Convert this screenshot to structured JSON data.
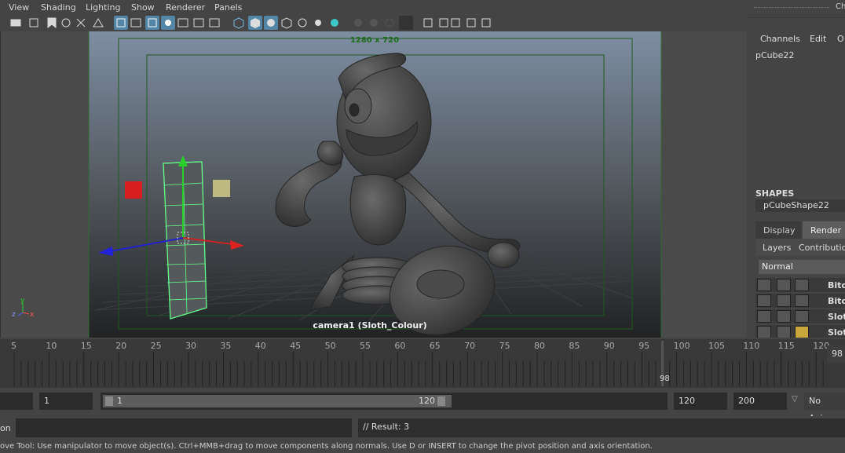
{
  "menu": [
    "View",
    "Shading",
    "Lighting",
    "Show",
    "Renderer",
    "Panels"
  ],
  "viewport": {
    "resolution_label": "1280 x 720",
    "camera_label": "camera1 (Sloth_Colour)",
    "axis_labels": {
      "y": "y",
      "z": "z",
      "x": "x"
    }
  },
  "right_panel": {
    "top_label": "Ch",
    "channels_menu": [
      "Channels",
      "Edit",
      "O"
    ],
    "object_name": "pCube22",
    "shapes_header": "SHAPES",
    "shape_name": "pCubeShape22",
    "tabs": [
      "Display",
      "Render"
    ],
    "subtabs": [
      "Layers",
      "Contribution"
    ],
    "blend_mode": "Normal",
    "layers": [
      "Bitco",
      "Bitco",
      "Sloth",
      "Sloth"
    ]
  },
  "timeslider": {
    "ticks": [
      "5",
      "10",
      "15",
      "20",
      "25",
      "30",
      "35",
      "40",
      "45",
      "50",
      "55",
      "60",
      "65",
      "70",
      "75",
      "80",
      "85",
      "90",
      "95",
      "100",
      "105",
      "110",
      "115",
      "120"
    ],
    "current_frame": "98",
    "current_frame_field": "98"
  },
  "range": {
    "start_field": "1",
    "slider_start": "1",
    "slider_end": "120",
    "end_field": "120",
    "anim_end_field": "200",
    "anim_layer": "No Anim"
  },
  "command": {
    "label": "on",
    "input_value": "",
    "result": "// Result: 3"
  },
  "help_line": "ove Tool: Use manipulator to move object(s). Ctrl+MMB+drag to move components along normals. Use D or INSERT to change the pivot position and axis orientation."
}
